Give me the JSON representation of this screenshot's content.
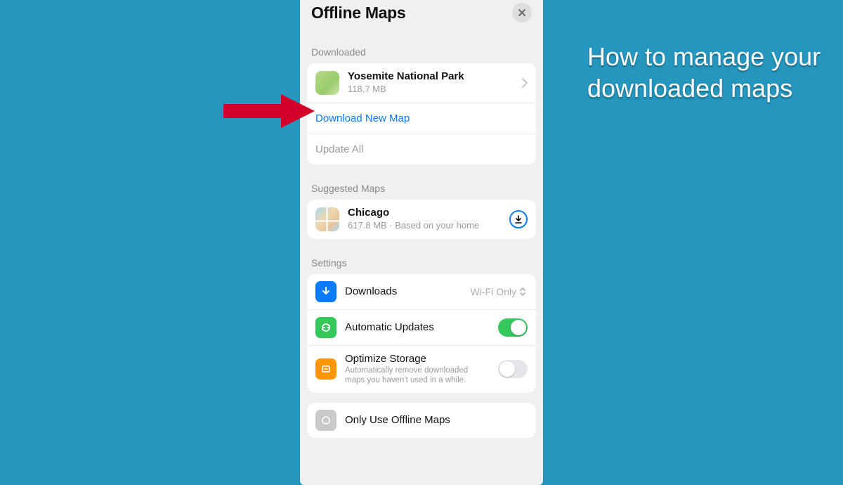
{
  "caption": "How to manage your downloaded maps",
  "header": {
    "title": "Offline Maps"
  },
  "sections": {
    "downloaded_label": "Downloaded",
    "suggested_label": "Suggested Maps",
    "settings_label": "Settings"
  },
  "downloaded": {
    "item": {
      "name": "Yosemite National Park",
      "size": "118.7 MB"
    },
    "download_new": "Download New Map",
    "update_all": "Update All"
  },
  "suggested": {
    "item": {
      "name": "Chicago",
      "sub": "617.8 MB · Based on your home"
    }
  },
  "settings": {
    "downloads": {
      "label": "Downloads",
      "value": "Wi-Fi Only"
    },
    "auto_updates": {
      "label": "Automatic Updates"
    },
    "optimize": {
      "label": "Optimize Storage",
      "desc": "Automatically remove downloaded maps you haven't used in a while."
    },
    "offline_only": {
      "label": "Only Use Offline Maps"
    }
  }
}
